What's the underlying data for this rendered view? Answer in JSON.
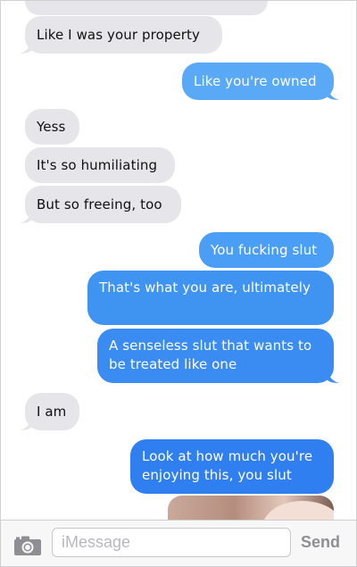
{
  "messages": [
    {
      "side": "received",
      "text": ""
    },
    {
      "side": "received",
      "text": "Like I was your property"
    },
    {
      "side": "sent",
      "text": "Like you're owned"
    },
    {
      "side": "received",
      "text": "Yess"
    },
    {
      "side": "received",
      "text": "It's so humiliating"
    },
    {
      "side": "received",
      "text": "But so freeing, too"
    },
    {
      "side": "sent",
      "text": "You fucking slut"
    },
    {
      "side": "sent",
      "text": "That's what you are, ultimately"
    },
    {
      "side": "sent",
      "text": "A senseless slut that wants to be treated like one"
    },
    {
      "side": "received",
      "text": "I am"
    },
    {
      "side": "sent",
      "text": "Look at how much you're enjoying this, you slut"
    }
  ],
  "colors": {
    "received_bubble": "#e5e5ea",
    "sent_light": "#5aa9f7",
    "sent_mid": "#3f93f1",
    "sent_dark": "#2f7ff0"
  },
  "composer": {
    "camera_icon": "camera-icon",
    "placeholder": "iMessage",
    "send_label": "Send"
  }
}
